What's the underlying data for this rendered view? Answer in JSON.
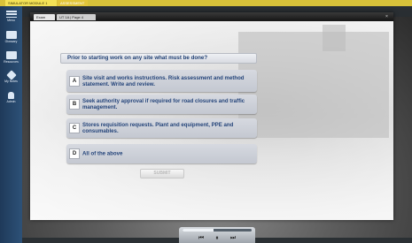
{
  "top_bar": {
    "tab1": "SIMULATOR MODULE 1",
    "tab2": "ASSESSMENT"
  },
  "sidebar": {
    "items": [
      {
        "label": "Menu",
        "icon": "menu-icon"
      },
      {
        "label": "Glossary",
        "icon": "book-icon"
      },
      {
        "label": "Resources",
        "icon": "folder-icon"
      },
      {
        "label": "My Notes",
        "icon": "pencil-icon"
      },
      {
        "label": "Admin",
        "icon": "user-icon"
      }
    ]
  },
  "window": {
    "tab1": "Exam",
    "tab2": "UT 1A | Page 4",
    "close": "×"
  },
  "quiz": {
    "question": "Prior to starting work on any site what must be done?",
    "options": [
      {
        "letter": "A",
        "text": "Site visit and works instructions. Risk assessment and method statement. Write and review."
      },
      {
        "letter": "B",
        "text": "Seek authority approval if required for road closures and traffic management."
      },
      {
        "letter": "C",
        "text": "Stores requisition requests. Plant and equipment, PPE and consumables."
      },
      {
        "letter": "D",
        "text": "All of the above"
      }
    ],
    "submit_label": "SUBMIT"
  },
  "player": {
    "progress": 0.45,
    "prev_icon": "skip-previous-icon",
    "pause_icon": "pause-icon",
    "next_icon": "skip-next-icon",
    "prev_glyph": "⏮",
    "pause_glyph": "⏸",
    "next_glyph": "⏭"
  },
  "colors": {
    "accent_yellow": "#f4e256",
    "question_text": "#1f3f73",
    "option_bg": "#c4c8d1",
    "sidebar_blue": "#2d5177"
  }
}
